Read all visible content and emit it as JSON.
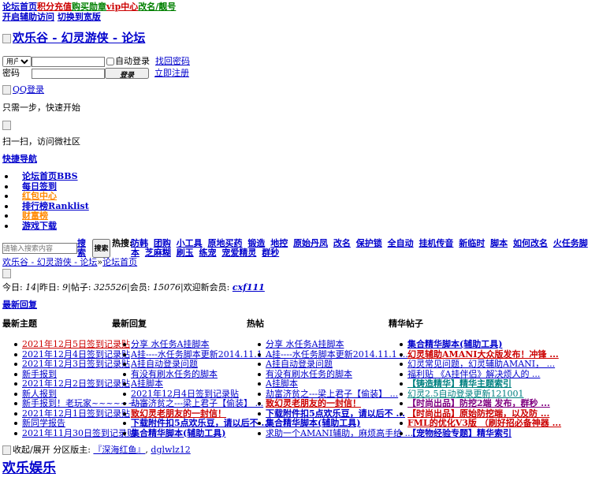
{
  "topnav": {
    "links": [
      {
        "label": "论坛首页",
        "color": "#0000cc"
      },
      {
        "label": "积分充值",
        "color": "#cc0000"
      },
      {
        "label": "购买勋章",
        "color": "#008000"
      },
      {
        "label": "vip中心",
        "color": "#cc0000"
      },
      {
        "label": "改名/靓号",
        "color": "#008000"
      }
    ],
    "row2": [
      "开启辅助访问",
      "切换到宽版"
    ]
  },
  "logo": {
    "alt": "欢乐谷 - 幻灵游侠 - 论坛"
  },
  "login": {
    "select_value": "用户名",
    "autologin_label": "自动登录",
    "find_password": "找回密码",
    "password_label": "密码",
    "login_button": "登录",
    "register": "立即注册"
  },
  "qq_login": "QQ登录",
  "one_step": "只需一步，快速开始",
  "scan_text": "扫一扫，访问微社区",
  "quick_nav": "快捷导航",
  "nav_items": [
    {
      "label": "论坛首页BBS",
      "color": "#0000cc"
    },
    {
      "label": "每日签到",
      "color": "#0000cc"
    },
    {
      "label": "红包中心",
      "color": "#ff8800"
    },
    {
      "label": "排行榜Ranklist",
      "color": "#0000cc"
    },
    {
      "label": "财富榜",
      "color": "#ff8800"
    },
    {
      "label": "游戏下载",
      "color": "#0000cc"
    }
  ],
  "search": {
    "placeholder": "请输入搜索内容",
    "link_label": "搜索",
    "button_label": "搜索",
    "hot_label": "热搜:",
    "hot_terms": [
      "防韩",
      "团购",
      "小工具",
      "原地买药",
      "锻造",
      "地控",
      "原始丹凤",
      "改名",
      "保护锁",
      "全自动",
      "挂机传音",
      "新临时",
      "脚本",
      "如何改名",
      "火任务脚本",
      "芝麻糊",
      "刷玉",
      "练宠",
      "宠爱精灵",
      "群秒"
    ]
  },
  "breadcrumb": {
    "site": "欢乐谷 - 幻灵游侠 - 论坛",
    "sep": "»",
    "current": "论坛首页"
  },
  "stats": {
    "today_label": "今日: ",
    "today": "14",
    "yesterday_label": "昨日: ",
    "yesterday": "9",
    "posts_label": "帖子: ",
    "posts": "325526",
    "members_label": "会员: ",
    "members": "15076",
    "welcome_label": "欢迎新会员: ",
    "new_member": "cxf111"
  },
  "latest_reply": "最新回复",
  "columns": [
    {
      "title": "最新主题",
      "items": [
        {
          "text": "2021年12月5日签到记录贴",
          "color": "#cc0000",
          "bold": false
        },
        {
          "text": "2021年12月4日签到记录贴",
          "color": "#0000cc",
          "bold": false
        },
        {
          "text": "2021年12月3日签到记录贴",
          "color": "#0000cc",
          "bold": false
        },
        {
          "text": "新手报到",
          "color": "#0000cc",
          "bold": false
        },
        {
          "text": "2021年12月2日签到记录贴",
          "color": "#0000cc",
          "bold": false
        },
        {
          "text": "新人报到",
          "color": "#0000cc",
          "bold": false
        },
        {
          "text": "新手报到！老玩家~~~~~~~~",
          "color": "#0000cc",
          "bold": false
        },
        {
          "text": "2021年12月1日签到记录贴",
          "color": "#0000cc",
          "bold": false
        },
        {
          "text": "新同学报告",
          "color": "#0000cc",
          "bold": false
        },
        {
          "text": "2021年11月30日签到记录贴",
          "color": "#0000cc",
          "bold": false
        }
      ]
    },
    {
      "title": "最新回复",
      "items": [
        {
          "text": "分享 水任务A挂脚本",
          "color": "#0000cc",
          "bold": false
        },
        {
          "text": "A挂----水任务脚本更新2014.11.1 ...",
          "color": "#0000cc",
          "bold": false
        },
        {
          "text": "A挂自动登录问题",
          "color": "#0000cc",
          "bold": false
        },
        {
          "text": "有没有刷水任务的脚本",
          "color": "#0000cc",
          "bold": false
        },
        {
          "text": "A挂脚本",
          "color": "#0000cc",
          "bold": false
        },
        {
          "text": "2021年12月4日签到记录贴",
          "color": "#0000cc",
          "bold": false
        },
        {
          "text": "劫富济贫之---梁上君子【偷装】 ...",
          "color": "#0000cc",
          "bold": false
        },
        {
          "text": "致幻灵老朋友的一封信！",
          "color": "#cc0000",
          "bold": true
        },
        {
          "text": "下载附件扣5点欢乐豆，请以后不 ...",
          "color": "#0000cc",
          "bold": true
        },
        {
          "text": "集合精华脚本(辅助工具)",
          "color": "#0000cc",
          "bold": true
        }
      ]
    },
    {
      "title": "热帖",
      "items": [
        {
          "text": "分享 水任务A挂脚本",
          "color": "#0000cc",
          "bold": false
        },
        {
          "text": "A挂----水任务脚本更新2014.11.1 ...",
          "color": "#0000cc",
          "bold": false
        },
        {
          "text": "A挂自动登录问题",
          "color": "#0000cc",
          "bold": false
        },
        {
          "text": "有没有刷水任务的脚本",
          "color": "#0000cc",
          "bold": false
        },
        {
          "text": "A挂脚本",
          "color": "#0000cc",
          "bold": false
        },
        {
          "text": "劫富济贫之---梁上君子【偷装】 ...",
          "color": "#0000cc",
          "bold": false
        },
        {
          "text": "致幻灵老朋友的一封信！",
          "color": "#cc0000",
          "bold": true
        },
        {
          "text": "下载附件扣5点欢乐豆，请以后不 ...",
          "color": "#0000cc",
          "bold": true
        },
        {
          "text": "集合精华脚本(辅助工具)",
          "color": "#0000cc",
          "bold": true
        },
        {
          "text": "求助一个AMANI辅助，麻烦高手给 ...",
          "color": "#0000cc",
          "bold": false
        }
      ]
    },
    {
      "title": "精华帖子",
      "items": [
        {
          "text": "集合精华脚本(辅助工具)",
          "color": "#0000cc",
          "bold": true
        },
        {
          "text": "幻灵辅助AMANI大众版发布！冲锋 ...",
          "color": "#cc0000",
          "bold": true
        },
        {
          "text": "幻灵常见问题，幻灵辅助AMANI， ...",
          "color": "#0000cc",
          "bold": false
        },
        {
          "text": "福利贴 《A挂伴侣》解决烦人的 ...",
          "color": "#0000cc",
          "bold": false
        },
        {
          "text": "【铸造精华】精华主题索引",
          "color": "#008080",
          "bold": true
        },
        {
          "text": "幻灵2.5自动登录更新121001",
          "color": "#008080",
          "bold": false
        },
        {
          "text": "【时尚出品】防挖2端 发布，群秒 ...",
          "color": "#800080",
          "bold": true
        },
        {
          "text": "【时尚出品】原始防挖端，以及防 ...",
          "color": "#cc0000",
          "bold": true
        },
        {
          "text": "FML的优化V3版 （刷好招必备神器 ...",
          "color": "#cc0000",
          "bold": true
        },
        {
          "text": "【宠物经验专题】精华索引",
          "color": "#0000cc",
          "bold": true
        }
      ]
    }
  ],
  "footer": {
    "collapse_label": "收起/展开",
    "moderator_label": " 分区版主: ",
    "moderators": [
      "『深海红鱼』",
      "dglwlz12"
    ],
    "sep": ", "
  },
  "section_title": "欢乐娱乐"
}
